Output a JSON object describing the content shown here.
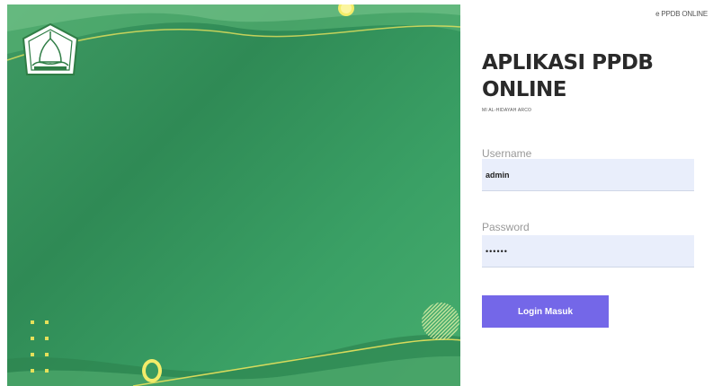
{
  "header": {
    "brand_link": "e PPDB ONLINE"
  },
  "form": {
    "title": "APLIKASI PPDB ONLINE",
    "subtitle": "MI AL-HIDAYAH ARCO",
    "username_label": "Username",
    "username_value": "admin",
    "password_label": "Password",
    "password_value": "••••••",
    "submit_label": "Login Masuk"
  },
  "colors": {
    "panel_green": "#3a9a60",
    "accent_yellow": "#e9e25c",
    "button_purple": "#7467e8",
    "input_bg": "#e9eefb"
  },
  "icons": {
    "logo": "school-emblem-icon"
  }
}
